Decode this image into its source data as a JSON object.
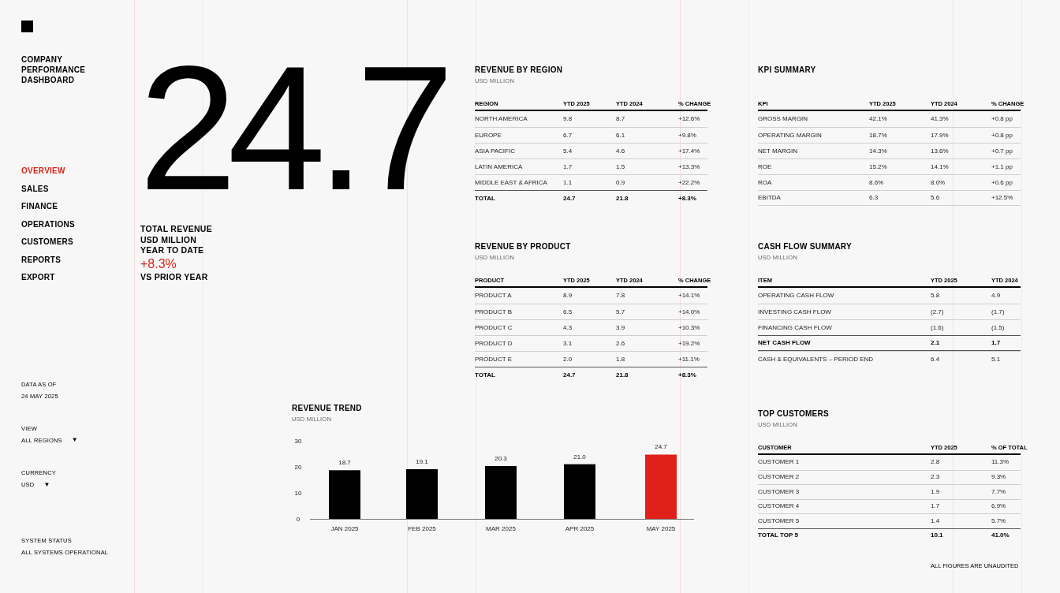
{
  "sidebar": {
    "title": "COMPANY PERFORMANCE DASHBOARD",
    "nav": [
      {
        "label": "OVERVIEW",
        "selected": true
      },
      {
        "label": "SALES",
        "selected": false
      },
      {
        "label": "FINANCE",
        "selected": false
      },
      {
        "label": "OPERATIONS",
        "selected": false
      },
      {
        "label": "CUSTOMERS",
        "selected": false
      },
      {
        "label": "REPORTS",
        "selected": false
      },
      {
        "label": "EXPORT",
        "selected": false
      }
    ],
    "data_as_of": {
      "label": "DATA AS OF",
      "value": "24 MAY 2025"
    },
    "filters": [
      {
        "label": "VIEW",
        "value": "ALL REGIONS",
        "caret": "▼"
      },
      {
        "label": "CURRENCY",
        "value": "USD",
        "caret": "▼"
      }
    ],
    "system_status": {
      "label": "SYSTEM STATUS",
      "value": "ALL SYSTEMS OPERATIONAL"
    }
  },
  "headline": {
    "value": "24.7",
    "lines": [
      "TOTAL REVENUE",
      "USD MILLION",
      "YEAR TO DATE"
    ],
    "change": "+8.3%",
    "comparison": "VS PRIOR YEAR"
  },
  "revenue_by_region": {
    "title": "REVENUE BY REGION",
    "subtitle": "USD MILLION",
    "columns": [
      "REGION",
      "YTD 2025",
      "YTD 2024",
      "% CHANGE"
    ],
    "rows": [
      {
        "kind": "normal",
        "cells": [
          "NORTH AMERICA",
          "9.8",
          "8.7",
          "+12.6%"
        ]
      },
      {
        "kind": "normal",
        "cells": [
          "EUROPE",
          "6.7",
          "6.1",
          "+9.8%"
        ]
      },
      {
        "kind": "normal",
        "cells": [
          "ASIA PACIFIC",
          "5.4",
          "4.6",
          "+17.4%"
        ]
      },
      {
        "kind": "normal",
        "cells": [
          "LATIN AMERICA",
          "1.7",
          "1.5",
          "+13.3%"
        ]
      },
      {
        "kind": "normal",
        "cells": [
          "MIDDLE EAST & AFRICA",
          "1.1",
          "0.9",
          "+22.2%"
        ]
      },
      {
        "kind": "total",
        "cells": [
          "TOTAL",
          "24.7",
          "21.8",
          "+8.3%"
        ]
      }
    ]
  },
  "revenue_by_product": {
    "title": "REVENUE BY PRODUCT",
    "subtitle": "USD MILLION",
    "columns": [
      "PRODUCT",
      "YTD 2025",
      "YTD 2024",
      "% CHANGE"
    ],
    "rows": [
      {
        "kind": "normal",
        "cells": [
          "PRODUCT A",
          "8.9",
          "7.8",
          "+14.1%"
        ]
      },
      {
        "kind": "normal",
        "cells": [
          "PRODUCT B",
          "6.5",
          "5.7",
          "+14.0%"
        ]
      },
      {
        "kind": "normal",
        "cells": [
          "PRODUCT C",
          "4.3",
          "3.9",
          "+10.3%"
        ]
      },
      {
        "kind": "normal",
        "cells": [
          "PRODUCT D",
          "3.1",
          "2.6",
          "+19.2%"
        ]
      },
      {
        "kind": "normal",
        "cells": [
          "PRODUCT E",
          "2.0",
          "1.8",
          "+11.1%"
        ]
      },
      {
        "kind": "total",
        "cells": [
          "TOTAL",
          "24.7",
          "21.8",
          "+8.3%"
        ]
      }
    ]
  },
  "revenue_trend": {
    "title": "REVENUE TREND",
    "subtitle": "USD MILLION",
    "chart_data": {
      "type": "bar",
      "categories": [
        "JAN 2025",
        "FEB 2025",
        "MAR 2025",
        "APR 2025",
        "MAY 2025"
      ],
      "value_labels": [
        "18.7",
        "19.1",
        "20.3",
        "21.0",
        "24.7"
      ],
      "ylim": [
        0,
        30
      ],
      "yticks": [
        0,
        10,
        20,
        30
      ],
      "series": [
        {
          "color": "#000000",
          "values": [
            18.7,
            19.1,
            20.3,
            21.0,
            null
          ]
        },
        {
          "color": "#e0201a",
          "values": [
            null,
            null,
            null,
            null,
            24.7
          ]
        }
      ]
    }
  },
  "kpi_summary": {
    "title": "KPI SUMMARY",
    "columns": [
      "KPI",
      "YTD 2025",
      "YTD 2024",
      "% CHANGE"
    ],
    "rows": [
      {
        "kind": "normal",
        "cells": [
          "GROSS MARGIN",
          "42.1%",
          "41.3%",
          "+0.8 pp"
        ]
      },
      {
        "kind": "normal",
        "cells": [
          "OPERATING MARGIN",
          "18.7%",
          "17.9%",
          "+0.8 pp"
        ]
      },
      {
        "kind": "normal",
        "cells": [
          "NET MARGIN",
          "14.3%",
          "13.6%",
          "+0.7 pp"
        ]
      },
      {
        "kind": "normal",
        "cells": [
          "ROE",
          "15.2%",
          "14.1%",
          "+1.1 pp"
        ]
      },
      {
        "kind": "normal",
        "cells": [
          "ROA",
          "8.6%",
          "8.0%",
          "+0.6 pp"
        ]
      },
      {
        "kind": "ruled",
        "cells": [
          "EBITDA",
          "6.3",
          "5.6",
          "+12.5%"
        ]
      }
    ]
  },
  "cash_flow_summary": {
    "title": "CASH FLOW SUMMARY",
    "subtitle": "USD MILLION",
    "columns": [
      "ITEM",
      "YTD 2025",
      "YTD 2024"
    ],
    "rows": [
      {
        "kind": "normal",
        "cells": [
          "OPERATING CASH FLOW",
          "5.8",
          "4.9"
        ]
      },
      {
        "kind": "normal",
        "cells": [
          "INVESTING CASH FLOW",
          "(2.7)",
          "(1.7)"
        ]
      },
      {
        "kind": "normal",
        "cells": [
          "FINANCING CASH FLOW",
          "(1.6)",
          "(1.5)"
        ]
      },
      {
        "kind": "subtotal",
        "cells": [
          "NET CASH FLOW",
          "2.1",
          "1.7"
        ]
      },
      {
        "kind": "normal",
        "cells": [
          "CASH & EQUIVALENTS – PERIOD END",
          "6.4",
          "5.1"
        ]
      }
    ]
  },
  "top_customers": {
    "title": "TOP CUSTOMERS",
    "subtitle": "USD MILLION",
    "columns": [
      "CUSTOMER",
      "YTD 2025",
      "% OF TOTAL"
    ],
    "rows": [
      {
        "kind": "normal",
        "cells": [
          "CUSTOMER 1",
          "2.8",
          "11.3%"
        ]
      },
      {
        "kind": "normal",
        "cells": [
          "CUSTOMER 2",
          "2.3",
          "9.3%"
        ]
      },
      {
        "kind": "normal",
        "cells": [
          "CUSTOMER 3",
          "1.9",
          "7.7%"
        ]
      },
      {
        "kind": "normal",
        "cells": [
          "CUSTOMER 4",
          "1.7",
          "6.9%"
        ]
      },
      {
        "kind": "normal",
        "cells": [
          "CUSTOMER 5",
          "1.4",
          "5.7%"
        ]
      },
      {
        "kind": "total",
        "cells": [
          "TOTAL TOP 5",
          "10.1",
          "41.0%"
        ]
      }
    ]
  },
  "footnote": "ALL FIGURES ARE UNAUDITED"
}
